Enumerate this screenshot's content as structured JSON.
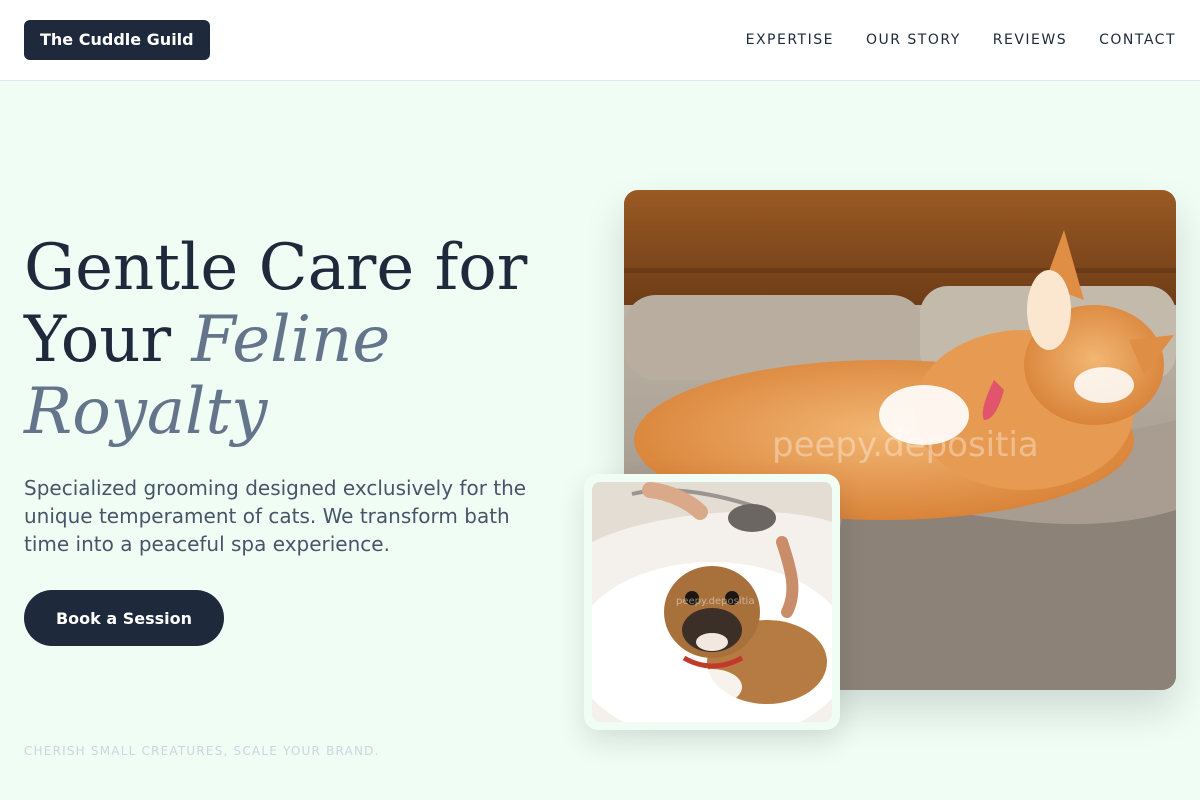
{
  "header": {
    "logo": "The Cuddle Guild",
    "nav": [
      "EXPERTISE",
      "OUR STORY",
      "REVIEWS",
      "CONTACT"
    ]
  },
  "hero": {
    "headline_line1": "Gentle Care for",
    "headline_line2_plain": "Your ",
    "headline_line2_accent": "Feline",
    "headline_line3_accent": "Royalty",
    "description": "Specialized grooming designed exclusively for the unique temperament of cats. We transform bath time into a peaceful spa experience.",
    "cta_label": "Book a Session",
    "tagline": "CHERISH SMALL CREATURES, SCALE YOUR BRAND."
  },
  "images": {
    "main": {
      "subject": "orange tabby cat lounging on a beige couch",
      "watermark": "peepy.depositia"
    },
    "inset": {
      "subject": "pug dog being bathed with a shower head",
      "watermark": "peepy.depositia"
    }
  },
  "colors": {
    "background": "#f0fdf4",
    "primary": "#1e293b",
    "accent_text": "#64748b",
    "body_text": "#475569",
    "muted": "#cbd5e1"
  }
}
